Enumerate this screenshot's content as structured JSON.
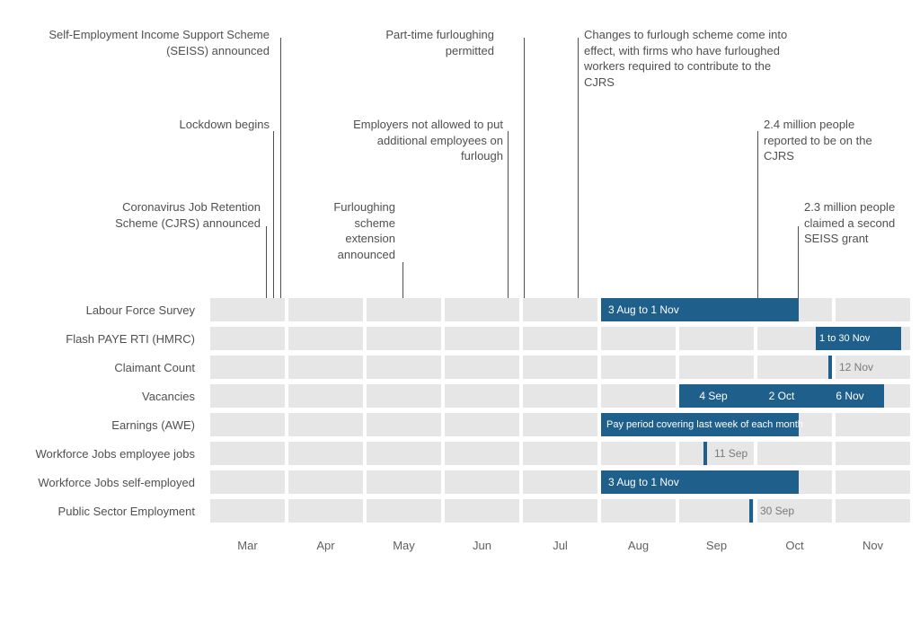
{
  "annotations": {
    "seiss_announced": "Self-Employment Income Support Scheme (SEISS) announced",
    "lockdown_begins": "Lockdown begins",
    "cjrs_announced": "Coronavirus Job Retention Scheme (CJRS) announced",
    "parttime_furlough": "Part-time furloughing permitted",
    "employers_not_allowed": "Employers not allowed to put additional employees on furlough",
    "furlough_extension": "Furloughing scheme extension announced",
    "changes_furlough": "Changes to furlough scheme come into effect, with firms who have furloughed workers required to contribute to the CJRS",
    "people_cjrs": "2.4 million people reported to be on the CJRS",
    "seiss_second": "2.3 million people claimed a second SEISS grant"
  },
  "rows": {
    "lfs": "Labour Force Survey",
    "paye": "Flash PAYE RTI (HMRC)",
    "claimant": "Claimant Count",
    "vacancies": "Vacancies",
    "earnings": "Earnings (AWE)",
    "wf_emp": "Workforce Jobs employee jobs",
    "wf_self": "Workforce Jobs self-employed",
    "public": "Public Sector Employment"
  },
  "periods": {
    "lfs_bar": "3 Aug to 1 Nov",
    "paye_bar": "1 to 30 Nov",
    "claimant_tick": "12 Nov",
    "vac_a": "4 Sep",
    "vac_b": "2 Oct",
    "vac_c": "6 Nov",
    "earnings_bar": "Pay period covering last week of each month",
    "wf_emp_tick": "11 Sep",
    "wf_self_bar": "3 Aug to 1 Nov",
    "public_tick": "30 Sep"
  },
  "months": {
    "m0": "Mar",
    "m1": "Apr",
    "m2": "May",
    "m3": "Jun",
    "m4": "Jul",
    "m5": "Aug",
    "m6": "Sep",
    "m7": "Oct",
    "m8": "Nov"
  },
  "chart_data": {
    "type": "table",
    "timeline_months": [
      "Mar",
      "Apr",
      "May",
      "Jun",
      "Jul",
      "Aug",
      "Sep",
      "Oct",
      "Nov"
    ],
    "events": [
      {
        "label": "Self-Employment Income Support Scheme (SEISS) announced",
        "date": "late Mar"
      },
      {
        "label": "Lockdown begins",
        "date": "late Mar"
      },
      {
        "label": "Coronavirus Job Retention Scheme (CJRS) announced",
        "date": "late Mar"
      },
      {
        "label": "Furloughing scheme extension announced",
        "date": "mid May"
      },
      {
        "label": "Employers not allowed to put additional employees on furlough",
        "date": "early Jun"
      },
      {
        "label": "Part-time furloughing permitted",
        "date": "early Jul"
      },
      {
        "label": "Changes to furlough scheme come into effect, with firms who have furloughed workers required to contribute to the CJRS",
        "date": "early Aug"
      },
      {
        "label": "2.4 million people reported to be on the CJRS",
        "date": "mid Oct"
      },
      {
        "label": "2.3 million people claimed a second SEISS grant",
        "date": "early Nov"
      }
    ],
    "data_sources": [
      {
        "name": "Labour Force Survey",
        "coverage": "3 Aug to 1 Nov"
      },
      {
        "name": "Flash PAYE RTI (HMRC)",
        "coverage": "1 to 30 Nov"
      },
      {
        "name": "Claimant Count",
        "reference_point": "12 Nov"
      },
      {
        "name": "Vacancies",
        "reference_points": [
          "4 Sep",
          "2 Oct",
          "6 Nov"
        ],
        "coverage": "Sep to Nov"
      },
      {
        "name": "Earnings (AWE)",
        "coverage": "Pay period covering last week of each month (Aug–Oct)"
      },
      {
        "name": "Workforce Jobs employee jobs",
        "reference_point": "11 Sep"
      },
      {
        "name": "Workforce Jobs self-employed",
        "coverage": "3 Aug to 1 Nov"
      },
      {
        "name": "Public Sector Employment",
        "reference_point": "30 Sep"
      }
    ]
  }
}
